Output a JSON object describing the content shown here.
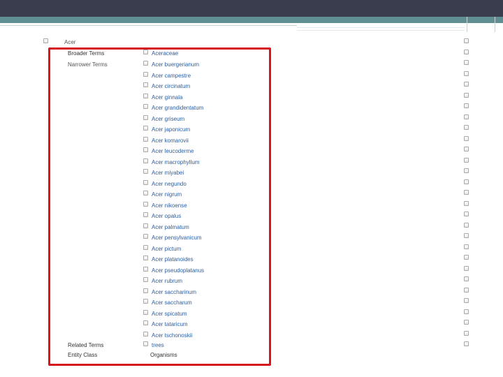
{
  "term": "Acer",
  "broader": {
    "label": "Broader Terms",
    "items": [
      "Aceraceae"
    ]
  },
  "narrower": {
    "label": "Narrower Terms",
    "items": [
      "Acer buergerianum",
      "Acer campestre",
      "Acer circinatum",
      "Acer ginnala",
      "Acer grandidentatum",
      "Acer griseum",
      "Acer japonicum",
      "Acer komarovii",
      "Acer leucoderme",
      "Acer macrophyllum",
      "Acer miyabei",
      "Acer negundo",
      "Acer nigrum",
      "Acer nikoense",
      "Acer opalus",
      "Acer palmatum",
      "Acer pensylvanicum",
      "Acer pictum",
      "Acer platanoides",
      "Acer pseudoplatanus",
      "Acer rubrum",
      "Acer saccharinum",
      "Acer saccharum",
      "Acer spicatum",
      "Acer tataricum",
      "Acer tschonoskii"
    ]
  },
  "related": {
    "label": "Related Terms",
    "items": [
      "trees"
    ]
  },
  "entity_class": {
    "label": "Entity Class",
    "value": "Organisms"
  },
  "colors": {
    "highlight": "#d6161c",
    "link": "#2a5fa6",
    "header": "#3a3d4d",
    "teal": "#5f8f92"
  }
}
